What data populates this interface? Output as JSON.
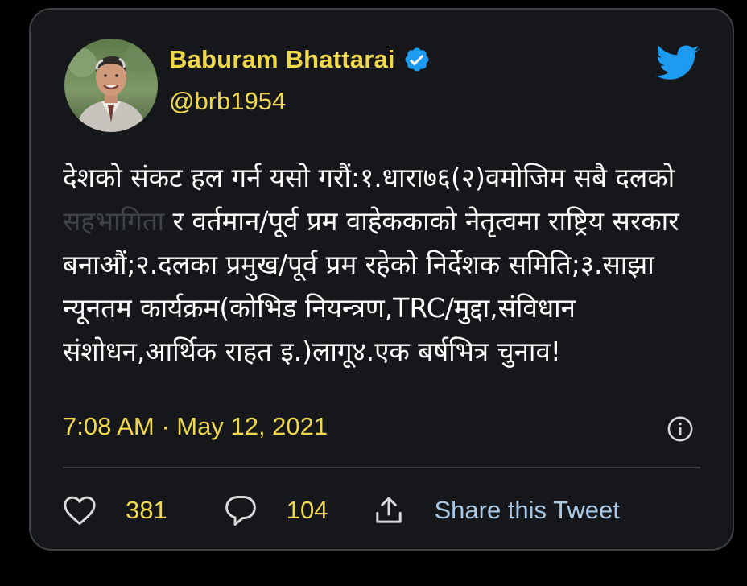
{
  "author": {
    "display_name": "Baburam Bhattarai",
    "handle": "@brb1954",
    "verified": true
  },
  "tweet": {
    "text_before_faded": "देशको संकट हल गर्न यसो गरौं:१.धारा७६(२)वमोजिम सबै दलको ",
    "text_faded": "सहभागिता",
    "text_after_faded": " र वर्तमान/पूर्व प्रम वाहेककाको नेतृत्वमा राष्ट्रिय सरकार बनाऔं;२.दलका प्रमुख/पूर्व प्रम रहेको निर्देशक समिति;३.साझा न्यूनतम कार्यक्रम(कोभिड नियन्त्रण,TRC/मुद्दा,संविधान संशोधन,आर्थिक राहत इ.)लागू४.एक बर्षभित्र चुनाव!",
    "timestamp": "7:08 AM · May 12, 2021"
  },
  "actions": {
    "likes": "381",
    "replies": "104",
    "share_label": "Share this Tweet"
  },
  "colors": {
    "accent_yellow": "#efd84b",
    "verified_blue": "#1d9bf0",
    "twitter_blue": "#1d9bf0",
    "share_text": "#a9c8e6",
    "card_bg": "#15171a",
    "border": "#3e4144"
  },
  "icons": {
    "verified": "verified-badge-icon",
    "brand": "twitter-bird-icon",
    "info": "info-icon",
    "like": "heart-icon",
    "reply": "speech-bubble-icon",
    "share": "upload-share-icon"
  }
}
